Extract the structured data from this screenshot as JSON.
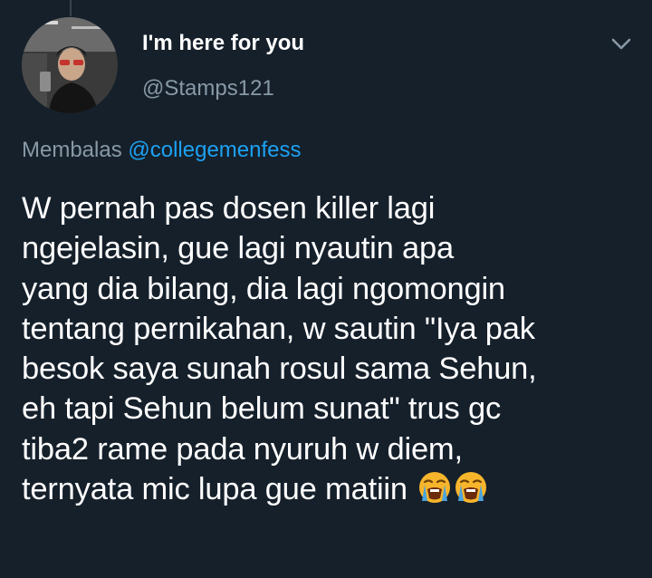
{
  "tweet": {
    "display_name": "I'm here for you",
    "handle": "@Stamps121",
    "reply_prefix": "Membalas",
    "reply_mention": "@collegemenfess",
    "text_lines": [
      "W pernah pas dosen killer lagi",
      "ngejelasin, gue lagi nyautin apa",
      "yang dia bilang, dia lagi ngomongin",
      "tentang pernikahan, w sautin \"Iya pak",
      "besok saya sunah rosul sama Sehun,",
      "eh tapi Sehun belum sunat\" trus gc",
      "tiba2 rame pada nyuruh w diem,",
      "ternyata mic lupa gue matiin"
    ],
    "trailing_emoji": [
      "loudly-crying-face-icon",
      "loudly-crying-face-icon"
    ],
    "menu_icon": "chevron-down-icon"
  },
  "colors": {
    "background": "#15202b",
    "primary_text": "#ffffff",
    "secondary_text": "#8899a6",
    "link": "#1da1f2"
  }
}
